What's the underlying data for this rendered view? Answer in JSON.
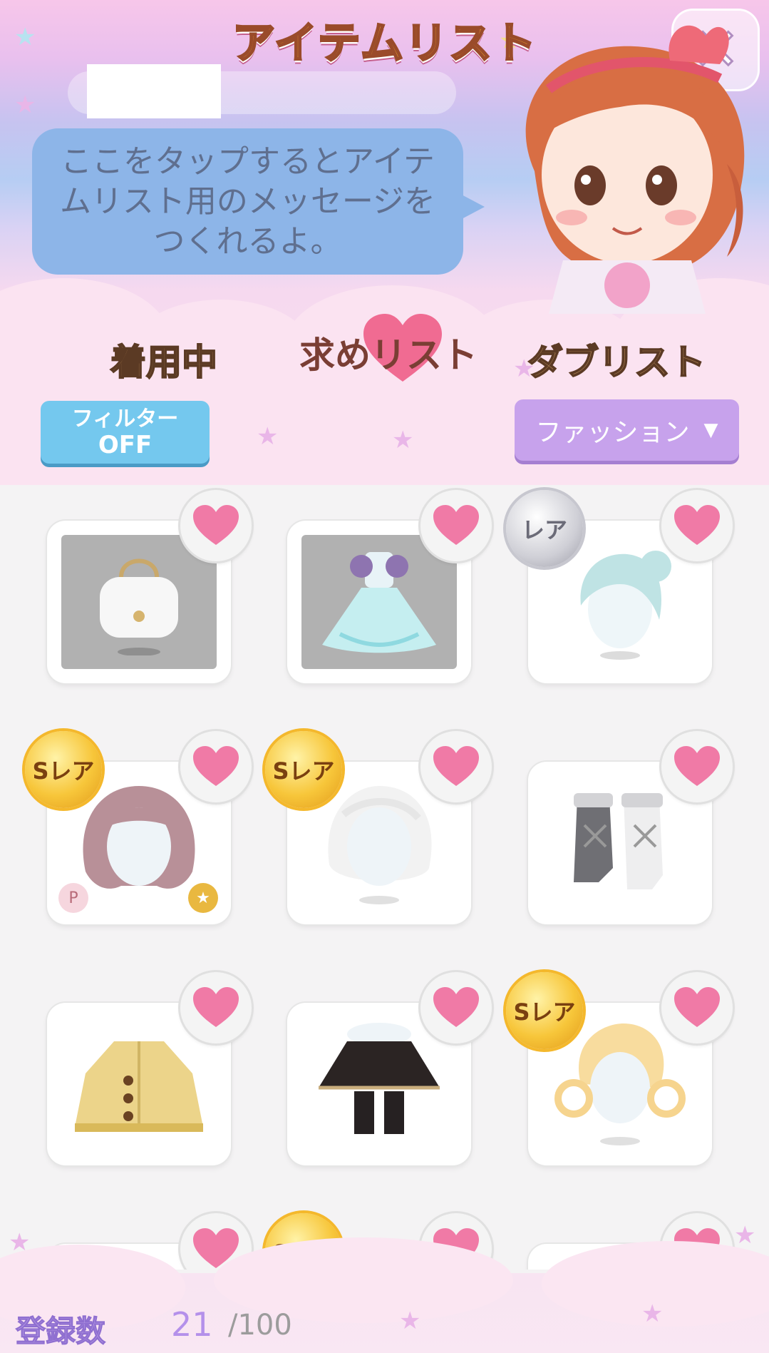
{
  "header": {
    "title": "アイテムリスト",
    "name_placeholder": "",
    "bubble_text": "ここをタップするとアイテムリスト用のメッセージをつくれるよ。",
    "close_icon": "close-icon"
  },
  "tabs": [
    {
      "label": "着用中"
    },
    {
      "label": "求めリスト"
    },
    {
      "label": "ダブリスト"
    }
  ],
  "filter": {
    "line1": "フィルター",
    "line2": "OFF"
  },
  "category": {
    "selected": "ファッション",
    "caret": "▼"
  },
  "items": [
    {
      "type": "bag",
      "owned": true,
      "rarity": ""
    },
    {
      "type": "dress",
      "owned": true,
      "rarity": ""
    },
    {
      "type": "hair-bun-mint",
      "owned": false,
      "rarity": "レア"
    },
    {
      "type": "hair-wavy-mauve",
      "owned": false,
      "rarity": "Sレア"
    },
    {
      "type": "hair-braid-white",
      "owned": false,
      "rarity": "Sレア"
    },
    {
      "type": "boots",
      "owned": false,
      "rarity": ""
    },
    {
      "type": "cardigan",
      "owned": false,
      "rarity": ""
    },
    {
      "type": "skirt",
      "owned": false,
      "rarity": ""
    },
    {
      "type": "hair-curls-blonde",
      "owned": false,
      "rarity": "Sレア"
    },
    {
      "type": "partial",
      "owned": false,
      "rarity": ""
    },
    {
      "type": "partial",
      "owned": false,
      "rarity": "Sレア"
    },
    {
      "type": "partial",
      "owned": false,
      "rarity": ""
    }
  ],
  "footer": {
    "label": "登録数",
    "count": "21",
    "max": "/100"
  },
  "colors": {
    "accent": "#b490ea",
    "heart": "#f07aa6",
    "filter": "#74c8ee",
    "select": "#c7a2ec"
  }
}
